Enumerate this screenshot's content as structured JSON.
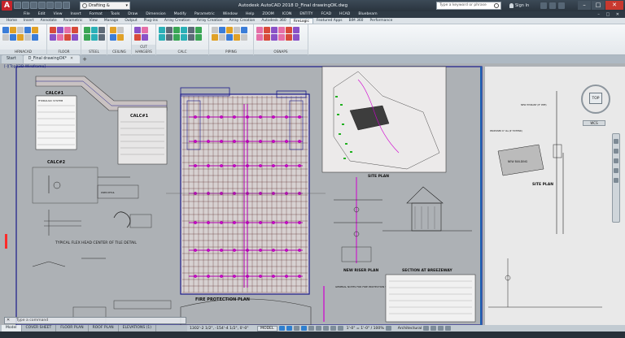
{
  "app": {
    "logo_letter": "A",
    "title": "Autodesk AutoCAD 2018    D_Final drawingOK.dwg",
    "workspace": "Drafting & Annotation",
    "search_placeholder": "Type a keyword or phrase",
    "sign_in": "Sign In",
    "window_controls": [
      "–",
      "□",
      "✕"
    ]
  },
  "menus": [
    "File",
    "Edit",
    "View",
    "Insert",
    "Format",
    "Tools",
    "Draw",
    "Dimension",
    "Modify",
    "Parametric",
    "Window",
    "Help",
    "ZOOM",
    "ICON",
    "ENTITY",
    "FCAD",
    "HCAD",
    "Bluebeam"
  ],
  "ribbon_tabs": [
    "Home",
    "Insert",
    "Annotate",
    "Parametric",
    "View",
    "Manage",
    "Output",
    "Plug-ins",
    "Array Creation",
    "Array Creation",
    "Array Creation",
    "Autodesk 360",
    "FireLogic",
    "Featured Apps",
    "BIM 360",
    "Performance"
  ],
  "active_ribbon_tab_index": 12,
  "ribbon_groups": [
    {
      "label": "HRNACAD"
    },
    {
      "label": "FLOOR"
    },
    {
      "label": "STEEL"
    },
    {
      "label": "CEILING"
    },
    {
      "label": "CUT HANGERS"
    },
    {
      "label": "CALC"
    },
    {
      "label": "PIPING"
    },
    {
      "label": "OSNAPS"
    }
  ],
  "file_tabs": [
    {
      "label": "Start",
      "active": false
    },
    {
      "label": "D_Final drawingOK*",
      "active": true
    }
  ],
  "viewport_label": "[-][Top][2D Wireframe]",
  "viewcube": {
    "face": "TOP",
    "wcs": "WCS"
  },
  "command_line": {
    "placeholder": "Type a command"
  },
  "drawing": {
    "title_left": "CALC#1",
    "title_mid": "CALC#1",
    "table_heading": "HYDRAULIC SYSTEM",
    "calc_left_bottom": "CALC#2",
    "flex_head": "TYPICAL FLEX HEAD CENTER OF TILE DETAIL",
    "riser_detail": "RISER DETAIL",
    "fire_protection_plan": "FIRE PROTECTION PLAN",
    "site_plan": "SITE PLAN",
    "site_plan_right": "SITE PLAN",
    "new_riser_plan": "NEW RISER PLAN",
    "section": "SECTION AT BREEZEWAY",
    "new_building": "NEW BUILDING",
    "notes_heading": "GENERAL NOTES FOR FIRE PROTECTION SYSTEM",
    "hydrant_note": "NEW HYDRANT (8\" PIPE)",
    "proposed_note": "PROPOSED 6\" dia (6\" EXTEND)"
  },
  "layout_tabs": [
    "Model",
    "COVER SHEET",
    "FLOOR PLAN",
    "ROOF PLAN",
    "ELEVATIONS (1)"
  ],
  "active_layout_tab_index": 0,
  "status": {
    "coords": "1302'-2 1/2\", -154'-4 1/2\", 0'-0\"",
    "model": "MODEL",
    "scale": "1'-0\" = 1'-0\" / 100%",
    "annoscale": "Architectural"
  },
  "colors": {
    "canvas": "#adb1b5",
    "sprinkler_pipe": "#b000b0",
    "grid_lines": "#5a2a2a",
    "walls": "#1a1a8a"
  }
}
